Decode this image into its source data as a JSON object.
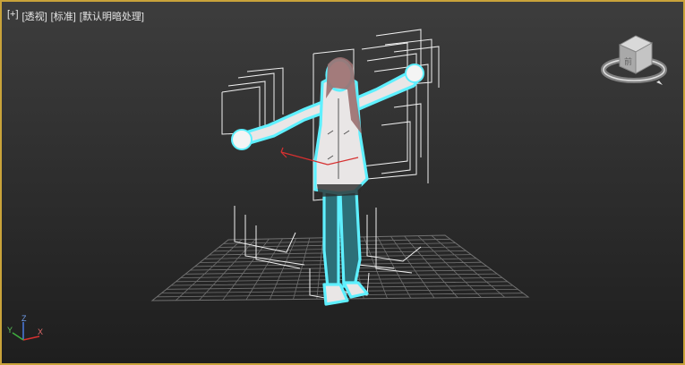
{
  "viewport": {
    "labels": [
      "[+]",
      "[透视]",
      "[标准]",
      "[默认明暗处理]"
    ],
    "border_color": "#c9a33a",
    "background_top": "#3d3d3d",
    "background_bottom": "#1e1e1e"
  },
  "viewcube": {
    "face_label": "前",
    "icon": "viewcube-icon"
  },
  "axis_tripod": {
    "x": "X",
    "y": "Y",
    "z": "Z"
  },
  "scene": {
    "object": "character-model",
    "selection_color": "#5ef0ff",
    "bone_box_color": "#f0f0f0",
    "grid_color": "#8a8a8a",
    "gizmo_color": "#d63030"
  }
}
